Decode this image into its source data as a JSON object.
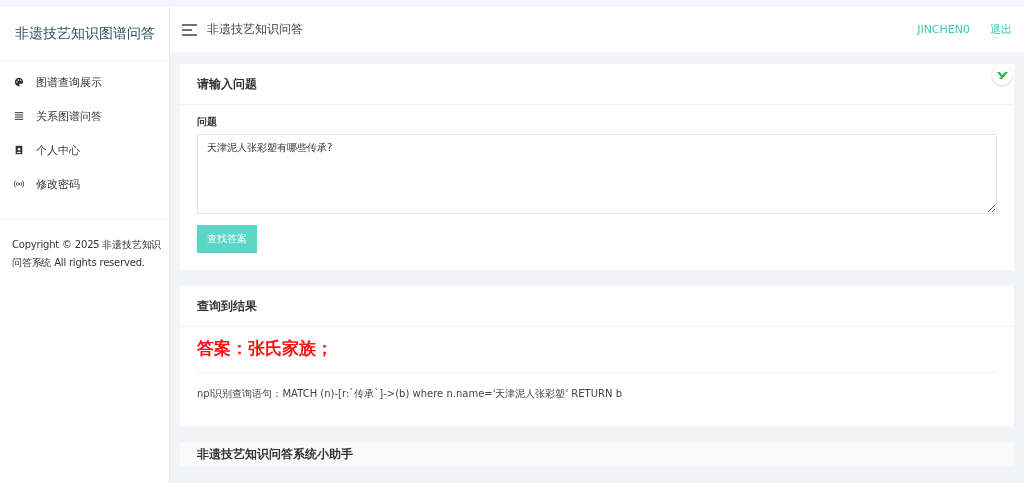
{
  "sidebar": {
    "title": "非遗技艺知识图谱问答",
    "items": [
      {
        "label": "图谱查询展示",
        "kind": "palette"
      },
      {
        "label": "关系图谱问答",
        "kind": "list"
      },
      {
        "label": "个人中心",
        "kind": "portrait"
      },
      {
        "label": "修改密码",
        "kind": "signal"
      }
    ],
    "footer": "Copyright © 2025 非遗技艺知识问答系统 All rights reserved."
  },
  "header": {
    "title": "非遗技艺知识问答",
    "user": "JINCHEN0",
    "logout": "退出"
  },
  "question_card": {
    "title": "请输入问题",
    "field_label": "问题",
    "value": "天津泥人张彩塑有哪些传承?",
    "button": "查找答案"
  },
  "result_card": {
    "title": "查询到结果",
    "answer": "答案：张氏家族；",
    "query": "npl识别查询语句：MATCH (n)-[r:`传承`]->(b) where n.name='天津泥人张彩塑' RETURN b"
  },
  "assistant_card": {
    "title": "非遗技艺知识问答系统小助手"
  }
}
